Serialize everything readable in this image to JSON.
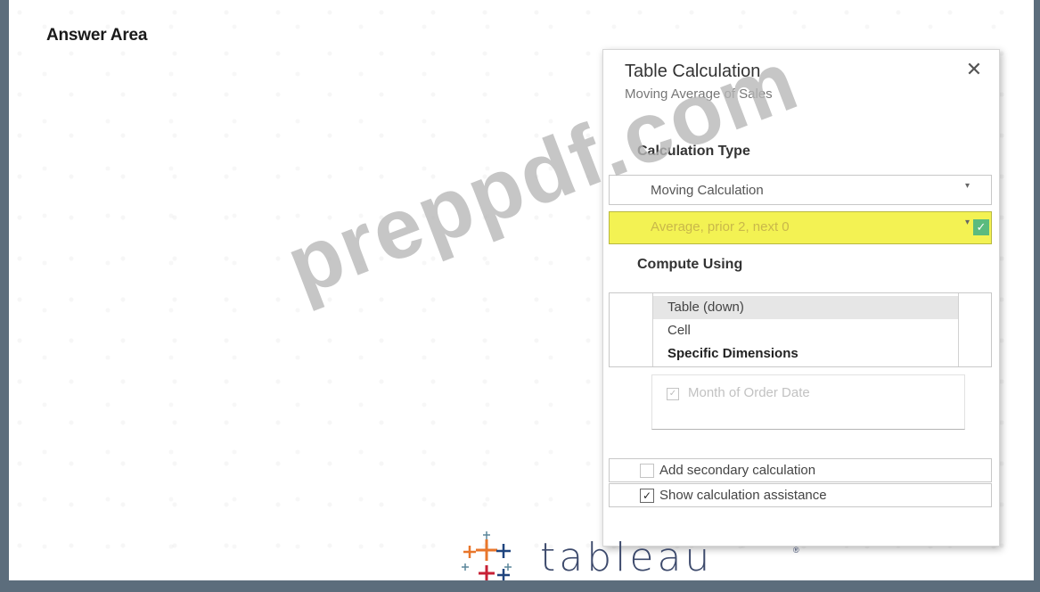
{
  "page": {
    "title": "Answer Area"
  },
  "dialog": {
    "title": "Table Calculation",
    "subtitle": "Moving Average of Sales",
    "close_symbol": "✕",
    "calculation_type": {
      "heading": "Calculation Type",
      "type_select": {
        "value": "Moving Calculation",
        "caret": "▾"
      },
      "aggregation_select": {
        "value": "Average, prior 2, next 0",
        "caret": "▾",
        "highlight_color": "#f3f253",
        "check_symbol": "✓"
      }
    },
    "compute_using": {
      "heading": "Compute Using",
      "options": [
        {
          "label": "Table (down)",
          "selected": true
        },
        {
          "label": "Cell",
          "selected": false
        },
        {
          "label": "Specific Dimensions",
          "selected": false
        }
      ],
      "dimensions": [
        {
          "label": "Month of Order Date",
          "checked": true,
          "check_symbol": "✓"
        }
      ]
    },
    "add_secondary": {
      "label": "Add secondary calculation",
      "checked": false,
      "check_symbol": ""
    },
    "show_assistance": {
      "label": "Show calculation assistance",
      "checked": true,
      "check_symbol": "✓"
    }
  },
  "watermark": {
    "text": "preppdf.com"
  },
  "logo": {
    "text": "tableau",
    "trademark": "®",
    "colors": {
      "orange": "#e8762b",
      "red": "#c72035",
      "blue": "#5b879b",
      "navy": "#1f447e"
    }
  }
}
